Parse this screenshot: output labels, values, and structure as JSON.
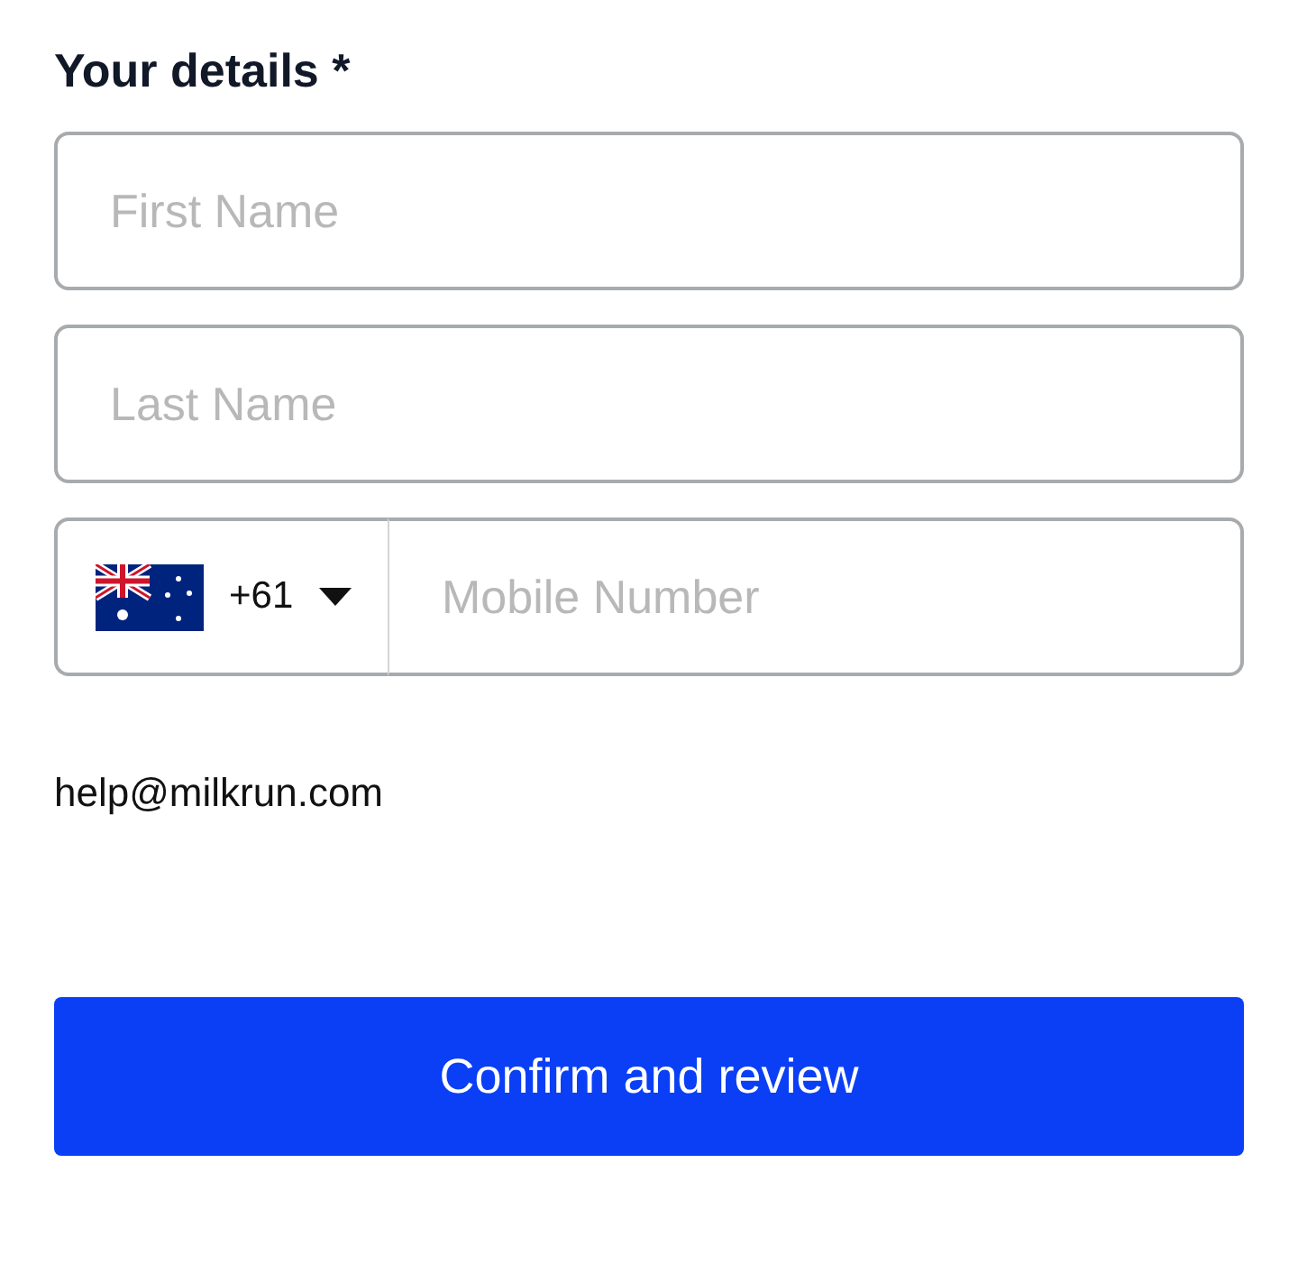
{
  "heading": "Your details *",
  "fields": [
    {
      "placeholder": "First Name"
    },
    {
      "placeholder": "Last Name"
    }
  ],
  "phone": {
    "country_code": "+61",
    "placeholder": "Mobile Number"
  },
  "email": "help@milkrun.com",
  "button": "Confirm and review"
}
